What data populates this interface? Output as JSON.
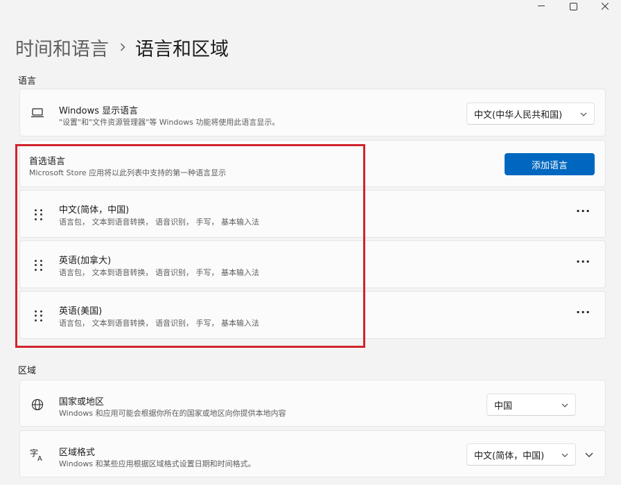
{
  "breadcrumb": {
    "parent": "时间和语言",
    "current": "语言和区域"
  },
  "language_section": {
    "label": "语言",
    "display_language": {
      "title": "Windows 显示语言",
      "subtitle": "\"设置\"和\"文件资源管理器\"等 Windows 功能将使用此语言显示。",
      "value": "中文(中华人民共和国)",
      "icon": "laptop-icon"
    },
    "preferred": {
      "title": "首选语言",
      "subtitle": "Microsoft Store 应用将以此列表中支持的第一种语言显示",
      "add_button": "添加语言",
      "items": [
        {
          "name": "中文(简体，中国)",
          "features": "语言包， 文本到语音转换， 语音识别， 手写， 基本输入法"
        },
        {
          "name": "英语(加拿大)",
          "features": "语言包， 文本到语音转换， 语音识别， 手写， 基本输入法"
        },
        {
          "name": "英语(美国)",
          "features": "语言包， 文本到语音转换， 语音识别， 手写， 基本输入法"
        }
      ]
    }
  },
  "region_section": {
    "label": "区域",
    "country": {
      "title": "国家或地区",
      "subtitle": "Windows 和应用可能会根据你所在的国家或地区向你提供本地内容",
      "value": "中国",
      "icon": "globe-icon"
    },
    "format": {
      "title": "区域格式",
      "subtitle": "Windows 和某些应用根据区域格式设置日期和时间格式。",
      "value": "中文(简体，中国)",
      "icon": "regional-format-icon"
    }
  },
  "colors": {
    "accent": "#0067c0",
    "highlight": "#d0232a"
  }
}
